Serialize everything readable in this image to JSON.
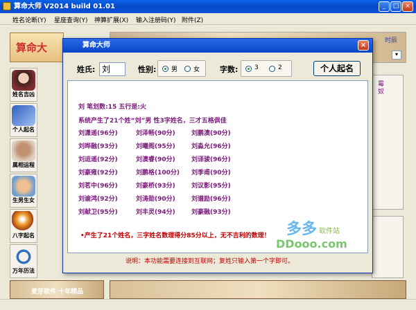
{
  "window": {
    "title": "算命大师  V2014 build 01.01"
  },
  "menu": [
    "姓名论断(Y)",
    "星座查询(Y)",
    "神算扩展(X)",
    "输入注册码(Y)",
    "附件(Z)"
  ],
  "banner": {
    "text": "算命大"
  },
  "sidebar": [
    {
      "label": "姓名吉凶",
      "icon": "lady-portrait-icon"
    },
    {
      "label": "个人起名",
      "icon": "notebook-pen-icon"
    },
    {
      "label": "属相运程",
      "icon": "cat-zodiac-icon"
    },
    {
      "label": "生男生女",
      "icon": "baby-icon"
    },
    {
      "label": "八字起名",
      "icon": "crystal-ball-icon"
    },
    {
      "label": "万年历法",
      "icon": "calendar-ring-icon"
    }
  ],
  "background_panel": {
    "label": "时辰",
    "extra_label": "霉 奴"
  },
  "bottom_strip_left": "麦芽软件 十年精品",
  "dialog": {
    "title": "算命大师",
    "close_label": "×",
    "surname_label": "姓氏:",
    "surname_value": "刘",
    "gender_label": "性别:",
    "gender_options": [
      "男",
      "女"
    ],
    "gender_selected": "男",
    "chars_label": "字数:",
    "chars_options": [
      "3",
      "2"
    ],
    "chars_selected": "3",
    "generate_button": "个人起名",
    "line1": "刘  笔划数:15  五行是:火",
    "line2": "系统产生了21个姓“刘”男  性3字姓名，三才五格俱佳",
    "names": [
      [
        "刘潇遥(96分)",
        "刘泽畅(90分)",
        "刘鹏澳(90分)"
      ],
      [
        "刘晔融(93分)",
        "刘曦阁(95分)",
        "刘淼允(96分)"
      ],
      [
        "刘运遥(92分)",
        "刘澳睿(90分)",
        "刘译骏(96分)"
      ],
      [
        "刘豪雍(92分)",
        "刘鹏格(100分)",
        "刘季甫(90分)"
      ],
      [
        "刘茗中(96分)",
        "刘豪桥(93分)",
        "刘议影(95分)"
      ],
      [
        "刘谕鸿(92分)",
        "刘涛勋(90分)",
        "刘谱励(96分)"
      ],
      [
        "刘献卫(95分)",
        "刘丰灵(94分)",
        "刘豪融(93分)"
      ]
    ],
    "summary": "•产生了21个姓名，三字姓名数理得分85分以上，无不吉利的数理！",
    "footer_note": "说明：本功能需要连接到互联网；复姓只输入第一个字即可。",
    "watermark": {
      "chars": "多多",
      "site_cn": "软件站",
      "site": "DDooo.com"
    }
  }
}
